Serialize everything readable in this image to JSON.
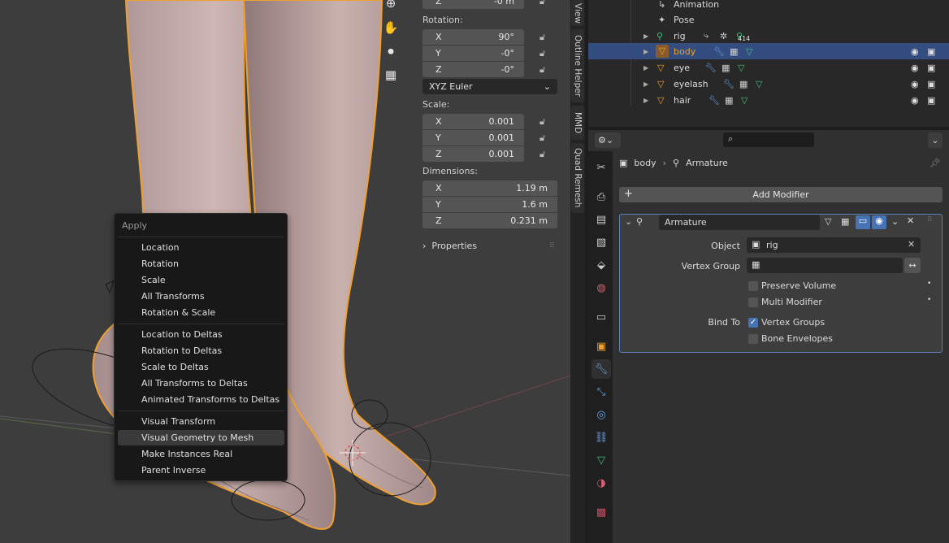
{
  "npanel": {
    "loc_z_label": "Z",
    "loc_z_value": "-0 m",
    "rotation_label": "Rotation:",
    "rot": [
      {
        "axis": "X",
        "value": "90°"
      },
      {
        "axis": "Y",
        "value": "-0°"
      },
      {
        "axis": "Z",
        "value": "-0°"
      }
    ],
    "rotation_mode": "XYZ Euler",
    "scale_label": "Scale:",
    "scale": [
      {
        "axis": "X",
        "value": "0.001"
      },
      {
        "axis": "Y",
        "value": "0.001"
      },
      {
        "axis": "Z",
        "value": "0.001"
      }
    ],
    "dimensions_label": "Dimensions:",
    "dims": [
      {
        "axis": "X",
        "value": "1.19 m"
      },
      {
        "axis": "Y",
        "value": "1.6 m"
      },
      {
        "axis": "Z",
        "value": "0.231 m"
      }
    ],
    "properties_label": "Properties"
  },
  "side_tabs": [
    "View",
    "Outline Helper",
    "MMD",
    "Quad Remesh"
  ],
  "outliner": {
    "rows": [
      {
        "name": "Animation"
      },
      {
        "name": "Pose"
      },
      {
        "name": "rig",
        "badge": "414"
      },
      {
        "name": "body",
        "selected": true
      },
      {
        "name": "eye"
      },
      {
        "name": "eyelash"
      },
      {
        "name": "hair"
      }
    ]
  },
  "properties": {
    "search_placeholder": "",
    "breadcrumb_object": "body",
    "breadcrumb_modifier": "Armature",
    "add_modifier_label": "Add Modifier",
    "modifier_name": "Armature",
    "object_label": "Object",
    "object_value": "rig",
    "vertex_group_label": "Vertex Group",
    "vertex_group_value": "",
    "preserve_volume_label": "Preserve Volume",
    "multi_modifier_label": "Multi Modifier",
    "bind_to_label": "Bind To",
    "vertex_groups_label": "Vertex Groups",
    "bone_envelopes_label": "Bone Envelopes"
  },
  "menu": {
    "title": "Apply",
    "groups": [
      [
        "Location",
        "Rotation",
        "Scale",
        "All Transforms",
        "Rotation & Scale"
      ],
      [
        "Location to Deltas",
        "Rotation to Deltas",
        "Scale to Deltas",
        "All Transforms to Deltas",
        "Animated Transforms to Deltas"
      ],
      [
        "Visual Transform",
        "Visual Geometry to Mesh",
        "Make Instances Real",
        "Parent Inverse"
      ]
    ],
    "highlighted": "Visual Geometry to Mesh"
  },
  "colors": {
    "selection": "#334d80",
    "accent": "#4772b3",
    "outline_orange": "#f0a030",
    "mesh_green": "#3fc07a",
    "modifier_blue": "#6aa0e0"
  }
}
